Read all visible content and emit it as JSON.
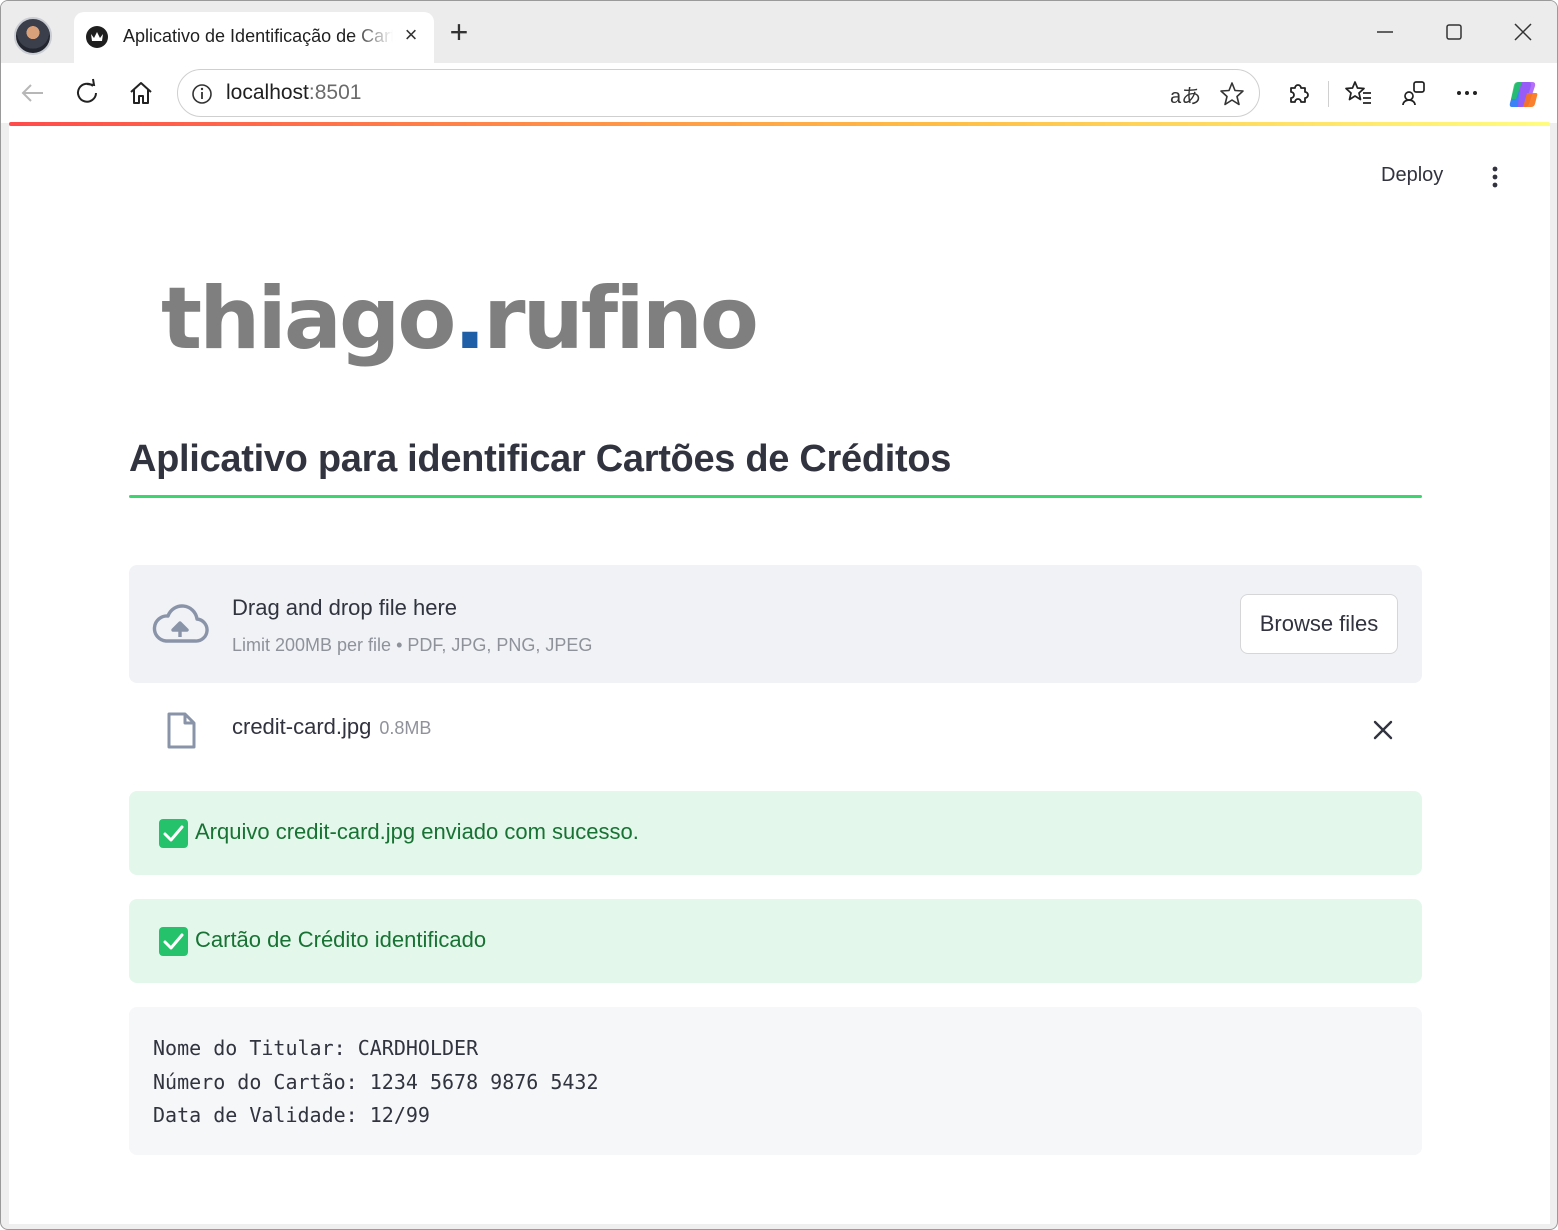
{
  "browser": {
    "tab_title": "Aplicativo de Identificação de Cartões de Créditos",
    "tab_close_glyph": "×",
    "new_tab_glyph": "+",
    "address": {
      "host": "localhost",
      "port": ":8501"
    },
    "translate_glyph": "aあ"
  },
  "header": {
    "deploy_label": "Deploy"
  },
  "logo": {
    "part1": "thiago",
    "dot": ".",
    "part2": "rufino",
    "dot_color": "#1f5fa8"
  },
  "main": {
    "title": "Aplicativo para identificar Cartões de Créditos",
    "uploader": {
      "drop_label": "Drag and drop file here",
      "limit_label": "Limit 200MB per file • PDF, JPG, PNG, JPEG",
      "browse_label": "Browse files"
    },
    "uploaded_file": {
      "name": "credit-card.jpg",
      "size": "0.8MB"
    },
    "alerts": [
      {
        "text": "Arquivo credit-card.jpg enviado com sucesso."
      },
      {
        "text": "Cartão de Crédito identificado"
      }
    ],
    "result_lines": [
      "Nome do Titular: CARDHOLDER",
      "Número do Cartão: 1234 5678 9876 5432",
      "Data de Validade: 12/99"
    ]
  },
  "colors": {
    "accent_green": "#3dd56d",
    "success_bg": "#e3f8eb",
    "success_text": "#177233",
    "check_green": "#26c26b"
  },
  "icons": [
    "avatar",
    "crown-icon",
    "close-icon",
    "plus-icon",
    "minimize-icon",
    "maximize-icon",
    "window-close-icon",
    "back-arrow-icon",
    "reload-icon",
    "home-icon",
    "info-icon",
    "translate-icon",
    "star-icon",
    "extensions-icon",
    "favorites-icon",
    "share-icon",
    "more-icon",
    "copilot-icon",
    "kebab-menu-icon",
    "cloud-upload-icon",
    "file-icon",
    "close-icon",
    "checkmark-icon"
  ]
}
